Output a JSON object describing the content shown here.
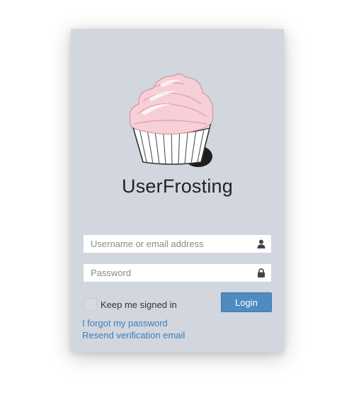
{
  "brand": {
    "name": "UserFrosting",
    "logo_icon": "cupcake-logo"
  },
  "form": {
    "username": {
      "placeholder": "Username or email address",
      "value": "",
      "icon": "user-icon"
    },
    "password": {
      "placeholder": "Password",
      "value": "",
      "icon": "lock-icon"
    },
    "remember_label": "Keep me signed in",
    "remember_checked": false,
    "login_label": "Login"
  },
  "links": {
    "forgot": "I forgot my password",
    "resend": "Resend verification email"
  },
  "colors": {
    "panel_bg": "#d2d6de",
    "button_bg": "#4f8bbf",
    "link": "#3c7fb7",
    "frosting": "#f4c6cf"
  }
}
